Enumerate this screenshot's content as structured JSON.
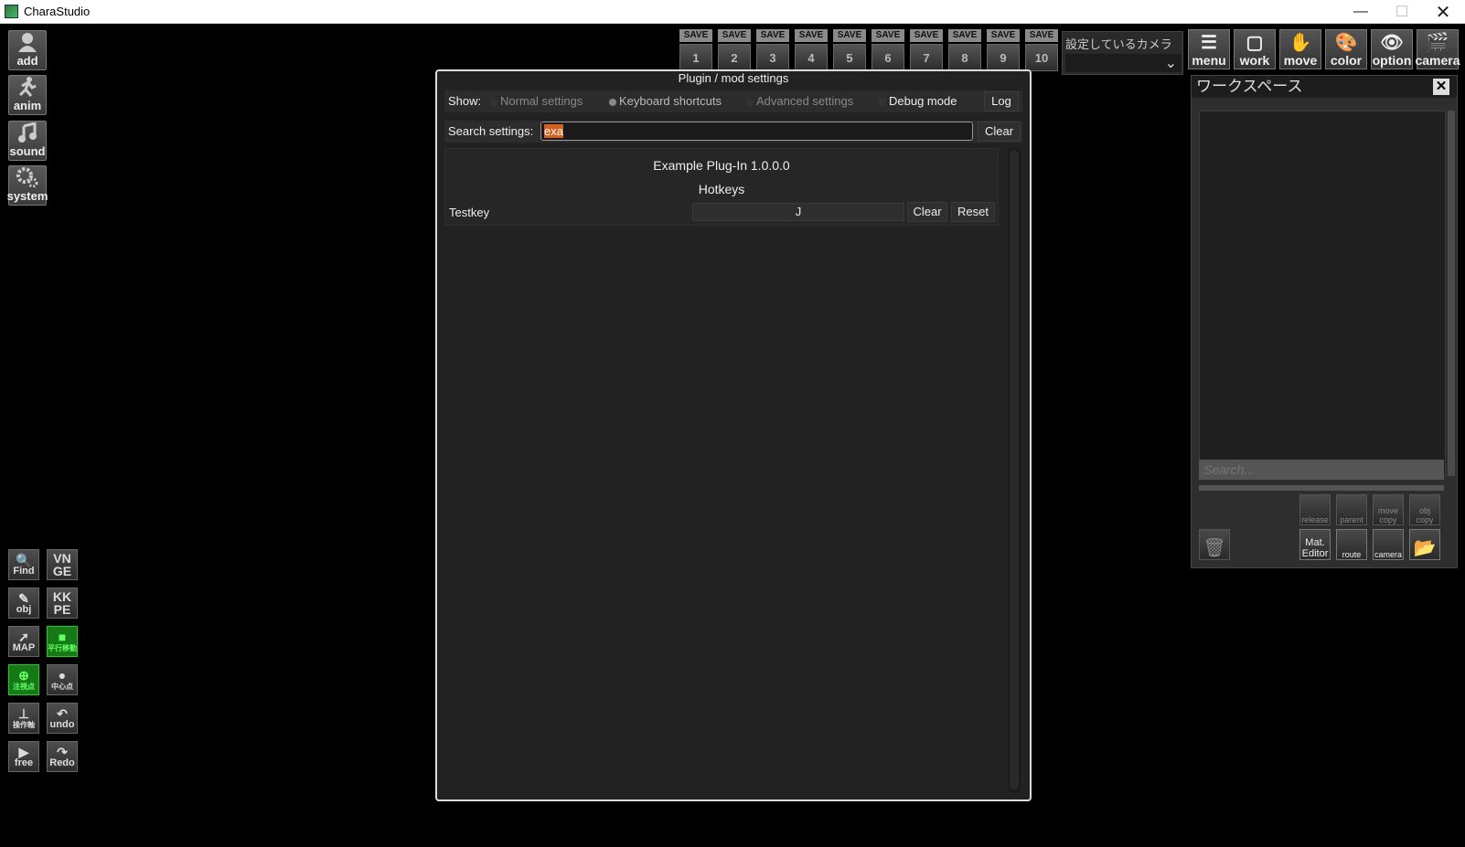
{
  "window": {
    "title": "CharaStudio",
    "minimize": "—",
    "maximize": "☐",
    "close": "✕"
  },
  "left_tools": [
    {
      "label": "add"
    },
    {
      "label": "anim"
    },
    {
      "label": "sound"
    },
    {
      "label": "system"
    }
  ],
  "bottom_tools": {
    "find": "Find",
    "vnge": [
      "VN",
      "GE"
    ],
    "obj": "obj",
    "kkpe": [
      "KK",
      "PE"
    ],
    "map": "MAP",
    "parallel": "平行移動",
    "gaze": "注視点",
    "center": "中心点",
    "axis": "操作軸",
    "undo": "undo",
    "free": "free",
    "redo": "Redo"
  },
  "save_slots": {
    "label": "SAVE",
    "numbers": [
      "1",
      "2",
      "3",
      "4",
      "5",
      "6",
      "7",
      "8",
      "9",
      "10"
    ]
  },
  "camera_select": {
    "label": "設定しているカメラ",
    "value": ""
  },
  "top_tools": [
    {
      "label": "menu",
      "icon": "☰"
    },
    {
      "label": "work",
      "icon": "▢"
    },
    {
      "label": "move",
      "icon": "✋"
    },
    {
      "label": "color",
      "icon": "🎨"
    },
    {
      "label": "option",
      "icon": "👁"
    },
    {
      "label": "camera",
      "icon": "🎬"
    }
  ],
  "workspace": {
    "title": "ワークスペース",
    "close": "✕",
    "search_placeholder": "Search...",
    "buttons": {
      "release": "release",
      "parent": "parent",
      "move_copy": "move copy",
      "obj_copy": "obj copy",
      "mat_editor": "Mat. Editor",
      "route": "route",
      "camera": "camera"
    }
  },
  "dialog": {
    "title": "Plugin / mod settings",
    "show_label": "Show:",
    "options": {
      "normal": "Normal settings",
      "keyboard": "Keyboard shortcuts",
      "advanced": "Advanced settings"
    },
    "debug_label": "Debug mode",
    "log_button": "Log",
    "search_label": "Search settings:",
    "search_value": "exa",
    "search_clear": "Clear",
    "plugin_name": "Example Plug-In 1.0.0.0",
    "section": "Hotkeys",
    "setting_name": "Testkey",
    "setting_value": "J",
    "setting_clear": "Clear",
    "setting_reset": "Reset"
  }
}
